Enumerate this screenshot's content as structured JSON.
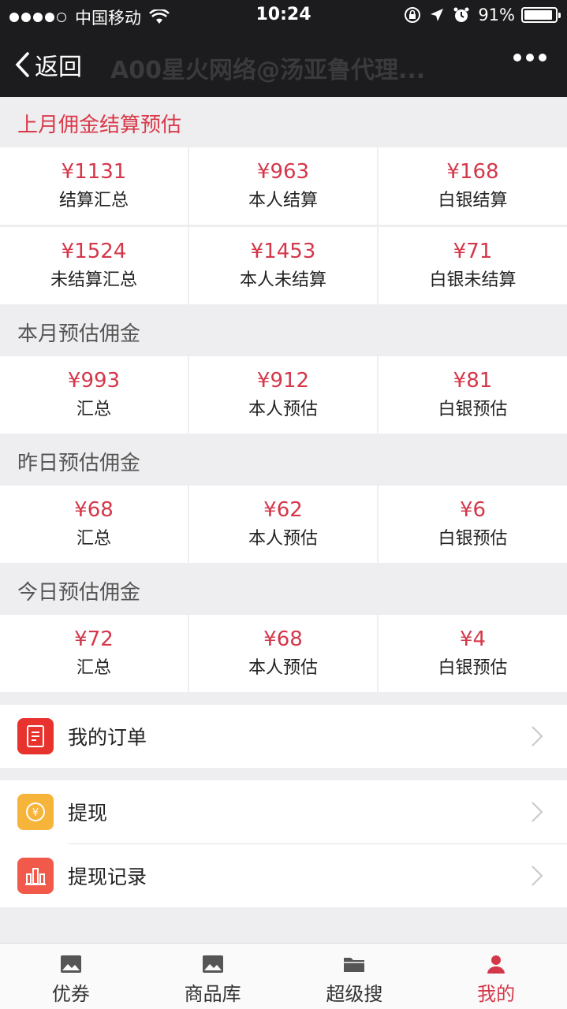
{
  "status_bar": {
    "carrier": "中国移动",
    "time": "10:24",
    "battery": "91%",
    "battery_level": 0.91
  },
  "nav": {
    "back_label": "返回",
    "title": "A00星火网络@汤亚鲁代理..."
  },
  "last_month": {
    "title": "上月佣金结算预估",
    "cells": [
      {
        "value": "¥1131",
        "label": "结算汇总"
      },
      {
        "value": "¥963",
        "label": "本人结算"
      },
      {
        "value": "¥168",
        "label": "白银结算"
      },
      {
        "value": "¥1524",
        "label": "未结算汇总"
      },
      {
        "value": "¥1453",
        "label": "本人未结算"
      },
      {
        "value": "¥71",
        "label": "白银未结算"
      }
    ]
  },
  "this_month": {
    "title": "本月预估佣金",
    "cells": [
      {
        "value": "¥993",
        "label": "汇总"
      },
      {
        "value": "¥912",
        "label": "本人预估"
      },
      {
        "value": "¥81",
        "label": "白银预估"
      }
    ]
  },
  "yesterday": {
    "title": "昨日预估佣金",
    "cells": [
      {
        "value": "¥68",
        "label": "汇总"
      },
      {
        "value": "¥62",
        "label": "本人预估"
      },
      {
        "value": "¥6",
        "label": "白银预估"
      }
    ]
  },
  "today": {
    "title": "今日预估佣金",
    "cells": [
      {
        "value": "¥72",
        "label": "汇总"
      },
      {
        "value": "¥68",
        "label": "本人预估"
      },
      {
        "value": "¥4",
        "label": "白银预估"
      }
    ]
  },
  "menu": {
    "orders": {
      "label": "我的订单",
      "icon": "order-icon",
      "color": "#e8322e"
    },
    "withdraw": {
      "label": "提现",
      "icon": "coin-icon",
      "color": "#f7b43a"
    },
    "withdraw_records": {
      "label": "提现记录",
      "icon": "bar-chart-icon",
      "color": "#f15a4a"
    }
  },
  "tabs": [
    {
      "label": "优券",
      "icon": "image-icon"
    },
    {
      "label": "商品库",
      "icon": "image-icon"
    },
    {
      "label": "超级搜",
      "icon": "folder-icon"
    },
    {
      "label": "我的",
      "icon": "user-icon"
    }
  ],
  "colors": {
    "accent": "#d4374a",
    "header": "#1c1c1e"
  }
}
